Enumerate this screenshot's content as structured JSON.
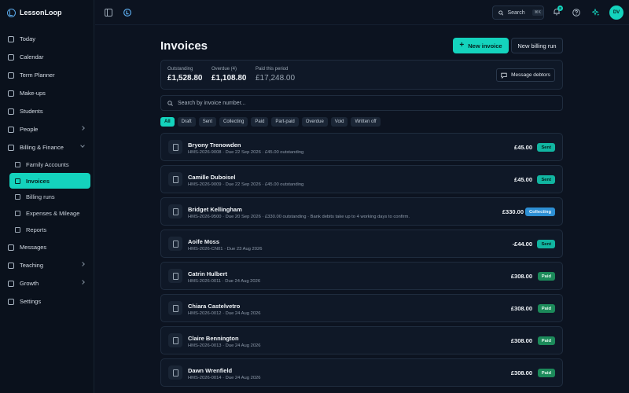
{
  "app": {
    "name": "LessonLoop"
  },
  "sidebar": {
    "items": [
      {
        "label": "Today",
        "icon": "sun-icon"
      },
      {
        "label": "Calendar",
        "icon": "calendar-icon"
      },
      {
        "label": "Term Planner",
        "icon": "planner-icon"
      },
      {
        "label": "Make-ups",
        "icon": "makeups-icon"
      },
      {
        "label": "Students",
        "icon": "students-icon"
      },
      {
        "label": "People",
        "icon": "people-icon",
        "chevron": "right"
      },
      {
        "label": "Billing & Finance",
        "icon": "billing-icon",
        "chevron": "down"
      }
    ],
    "sub_items": [
      {
        "label": "Family Accounts",
        "icon": "family-icon"
      },
      {
        "label": "Invoices",
        "icon": "invoice-icon",
        "active": true
      },
      {
        "label": "Billing runs",
        "icon": "billing-runs-icon"
      },
      {
        "label": "Expenses & Mileage",
        "icon": "expenses-icon"
      },
      {
        "label": "Reports",
        "icon": "reports-icon"
      }
    ],
    "items_after": [
      {
        "label": "Messages",
        "icon": "messages-icon"
      },
      {
        "label": "Teaching",
        "icon": "teaching-icon",
        "chevron": "right"
      },
      {
        "label": "Growth",
        "icon": "growth-icon",
        "chevron": "right"
      },
      {
        "label": "Settings",
        "icon": "settings-icon"
      }
    ]
  },
  "topbar": {
    "search_label": "Search",
    "search_shortcut": "⌘K",
    "notification_count": "8",
    "avatar_initials": "DV"
  },
  "page": {
    "title": "Invoices",
    "new_invoice_label": "New invoice",
    "new_billing_run_label": "New billing run"
  },
  "summary": {
    "outstanding_label": "Outstanding",
    "outstanding_value": "£1,528.80",
    "overdue_label": "Overdue (4)",
    "overdue_value": "£1,108.80",
    "paid_label": "Paid this period",
    "paid_value": "£17,248.00",
    "message_debtors_label": "Message debtors"
  },
  "search": {
    "placeholder": "Search by invoice number..."
  },
  "filters": [
    "All",
    "Draft",
    "Sent",
    "Collecting",
    "Paid",
    "Part-paid",
    "Overdue",
    "Void",
    "Written off"
  ],
  "invoices": [
    {
      "name": "Bryony Trenowden",
      "detail": "HMS-2026-9008 · Due 22 Sep 2026 · £45.00 outstanding",
      "amount": "£45.00",
      "status": "Sent",
      "status_key": "sent"
    },
    {
      "name": "Camille Duboisel",
      "detail": "HMS-2026-9009 · Due 22 Sep 2026 · £45.00 outstanding",
      "amount": "£45.00",
      "status": "Sent",
      "status_key": "sent"
    },
    {
      "name": "Bridget Kellingham",
      "detail": "HMS-2026-9500 · Due 20 Sep 2026 · £330.00 outstanding · Bank debits take up to 4 working days to confirm.",
      "amount": "£330.00",
      "status": "Collecting",
      "status_key": "collecting"
    },
    {
      "name": "Aoife Moss",
      "detail": "HMS-2026-CN01 · Due 23 Aug 2026",
      "amount": "-£44.00",
      "status": "Sent",
      "status_key": "sent"
    },
    {
      "name": "Catrin Hulbert",
      "detail": "HMS-2026-0011 · Due 24 Aug 2026",
      "amount": "£308.00",
      "status": "Paid",
      "status_key": "paid"
    },
    {
      "name": "Chiara Castelvetro",
      "detail": "HMS-2026-0012 · Due 24 Aug 2026",
      "amount": "£308.00",
      "status": "Paid",
      "status_key": "paid"
    },
    {
      "name": "Claire Bennington",
      "detail": "HMS-2026-0013 · Due 24 Aug 2026",
      "amount": "£308.00",
      "status": "Paid",
      "status_key": "paid"
    },
    {
      "name": "Dawn Wrenfield",
      "detail": "HMS-2026-0014 · Due 24 Aug 2026",
      "amount": "£308.00",
      "status": "Paid",
      "status_key": "paid"
    }
  ],
  "colors": {
    "accent": "#14d3bd",
    "background": "#0c1320",
    "sidebar": "#0a111c",
    "paid": "#1c8a5a",
    "collecting": "#2d8fd4"
  }
}
